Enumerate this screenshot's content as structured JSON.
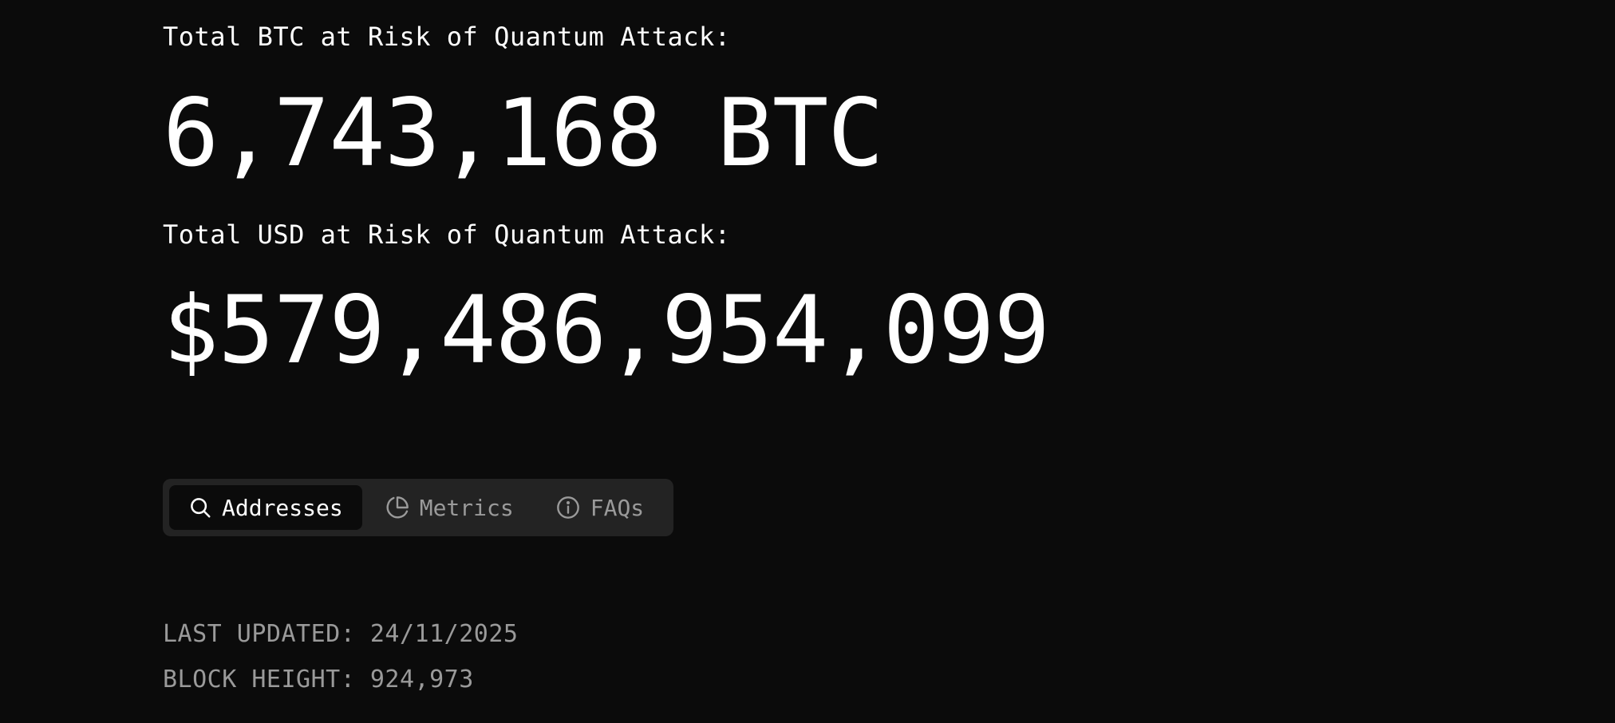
{
  "btc": {
    "label": "Total BTC at Risk of Quantum Attack:",
    "value": "6,743,168 BTC"
  },
  "usd": {
    "label": "Total USD at Risk of Quantum Attack:",
    "value": "$579,486,954,099"
  },
  "tabs": [
    {
      "label": "Addresses",
      "icon": "search-icon",
      "active": true
    },
    {
      "label": "Metrics",
      "icon": "pie-chart-icon",
      "active": false
    },
    {
      "label": "FAQs",
      "icon": "info-icon",
      "active": false
    }
  ],
  "meta": {
    "last_updated": "LAST UPDATED: 24/11/2025",
    "block_height": "BLOCK HEIGHT: 924,973"
  },
  "colors": {
    "background": "#0b0b0b",
    "tab_bar": "#232323",
    "text_primary": "#ffffff",
    "text_muted": "#9a9a9a"
  }
}
